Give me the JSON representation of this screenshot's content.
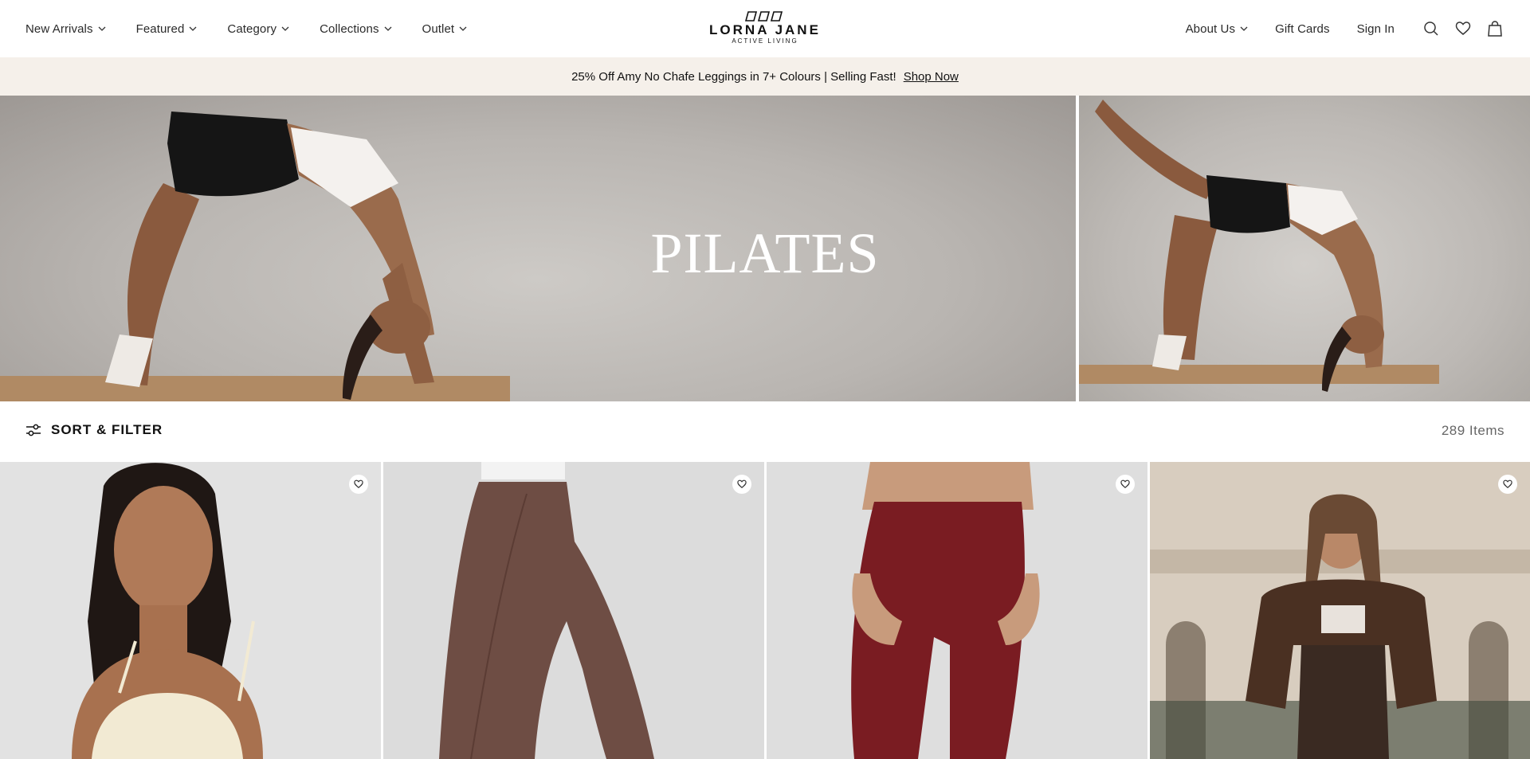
{
  "header": {
    "nav_left": [
      {
        "label": "New Arrivals",
        "has_dropdown": true
      },
      {
        "label": "Featured",
        "has_dropdown": true
      },
      {
        "label": "Category",
        "has_dropdown": true
      },
      {
        "label": "Collections",
        "has_dropdown": true
      },
      {
        "label": "Outlet",
        "has_dropdown": true
      }
    ],
    "logo": {
      "brand": "LORNA JANE",
      "tagline": "ACTIVE LIVING"
    },
    "nav_right": [
      {
        "label": "About Us",
        "has_dropdown": true
      },
      {
        "label": "Gift Cards",
        "has_dropdown": false
      },
      {
        "label": "Sign In",
        "has_dropdown": false
      }
    ],
    "icons": [
      "search-icon",
      "heart-icon",
      "bag-icon"
    ]
  },
  "promo": {
    "text": "25% Off Amy No Chafe Leggings in 7+ Colours | Selling Fast!",
    "link": "Shop Now"
  },
  "hero": {
    "title": "PILATES"
  },
  "toolbar": {
    "sort_filter_label": "SORT & FILTER",
    "item_count": "289 Items"
  },
  "products": [
    {
      "image": "model-cream-sports-bra",
      "wishlist_icon": "heart-icon"
    },
    {
      "image": "brown-leggings",
      "wishlist_icon": "heart-icon"
    },
    {
      "image": "burgundy-leggings",
      "wishlist_icon": "heart-icon"
    },
    {
      "image": "model-brown-cardigan-outdoor",
      "wishlist_icon": "heart-icon"
    }
  ],
  "colors": {
    "promo_bg": "#f5f0ea",
    "hero_bg": "#bdb9b5",
    "text": "#1a1a1a",
    "muted": "#666666"
  }
}
